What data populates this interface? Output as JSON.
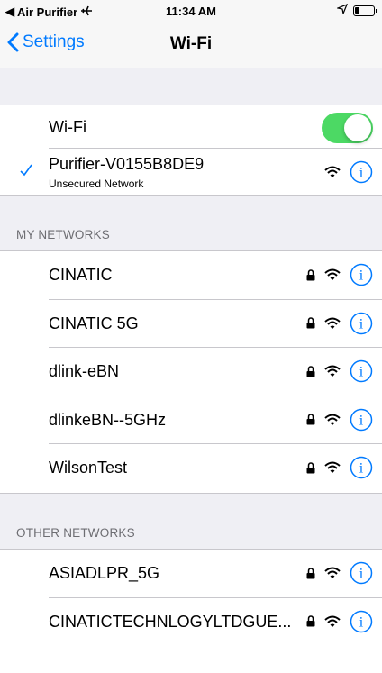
{
  "status_bar": {
    "back_app": "Air Purifier",
    "time": "11:34 AM",
    "battery_level": 0.25
  },
  "nav": {
    "back_label": "Settings",
    "title": "Wi-Fi"
  },
  "wifi_toggle": {
    "label": "Wi-Fi",
    "on": true,
    "color": "#4cd964"
  },
  "connected": {
    "name": "Purifier-V0155B8DE9",
    "status": "Unsecured Network"
  },
  "my_networks": {
    "header": "MY NETWORKS",
    "items": [
      {
        "name": "CINATIC",
        "locked": true
      },
      {
        "name": "CINATIC 5G",
        "locked": true
      },
      {
        "name": "dlink-eBN",
        "locked": true
      },
      {
        "name": "dlinkeBN--5GHz",
        "locked": true
      },
      {
        "name": "WilsonTest",
        "locked": true
      }
    ]
  },
  "other_networks": {
    "header": "OTHER NETWORKS",
    "items": [
      {
        "name": "ASIADLPR_5G",
        "locked": true
      },
      {
        "name": "CINATICTECHNLOGYLTDGUE...",
        "locked": true
      }
    ]
  },
  "accent_color": "#007aff"
}
